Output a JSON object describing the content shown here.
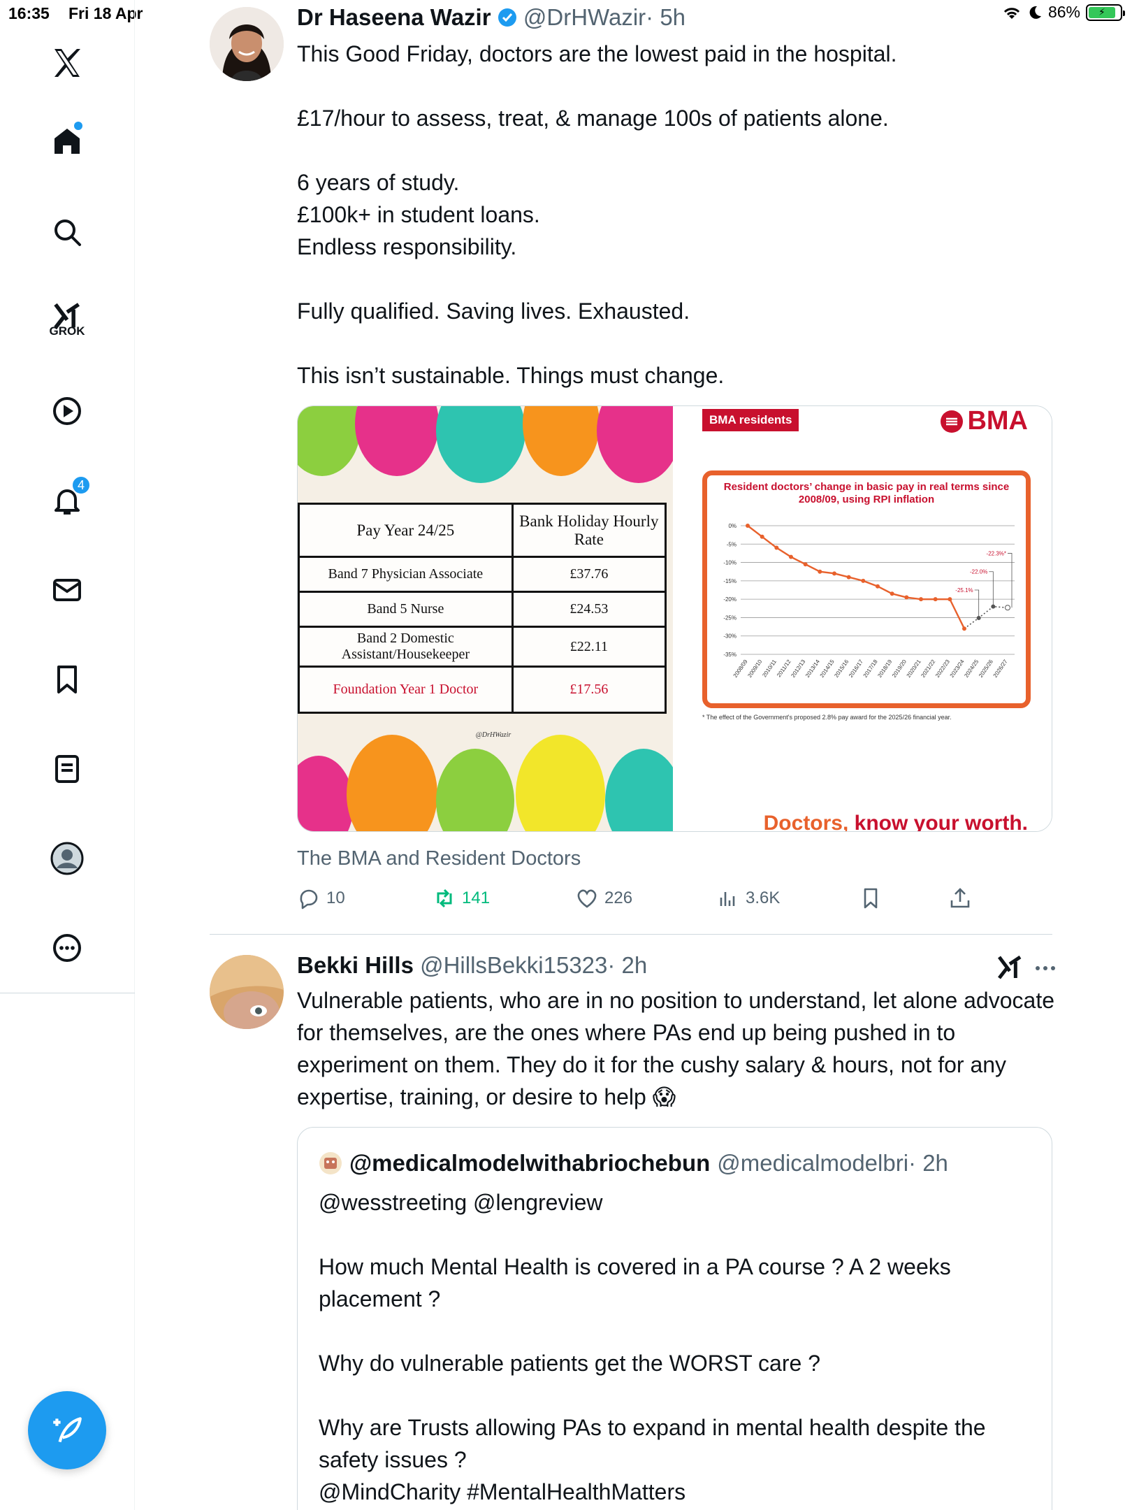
{
  "status_bar": {
    "time": "16:35",
    "date": "Fri 18 Apr",
    "battery": "86%"
  },
  "sidebar": {
    "items": [
      {
        "name": "x-logo"
      },
      {
        "name": "home"
      },
      {
        "name": "search"
      },
      {
        "name": "grok",
        "label": "GROK"
      },
      {
        "name": "videos"
      },
      {
        "name": "notifications",
        "badge": "4"
      },
      {
        "name": "messages"
      },
      {
        "name": "bookmarks"
      },
      {
        "name": "lists"
      },
      {
        "name": "profile"
      },
      {
        "name": "more"
      }
    ],
    "compose_icon": "compose-icon"
  },
  "tweet1": {
    "name": "Dr Haseena Wazir",
    "handle": "@DrHWazir",
    "time": "· 5h",
    "text": "This Good Friday, doctors are the lowest paid in the hospital.\n\n£17/hour to assess, treat, & manage 100s of patients alone.\n\n6 years of study.\n£100k+ in student loans.\nEndless responsibility.\n\nFully qualified. Saving lives. Exhausted.\n\nThis isn’t sustainable. Things must change.",
    "caption": "The BMA and Resident Doctors",
    "replies": "10",
    "reposts": "141",
    "likes": "226",
    "views": "3.6K",
    "pay_table": {
      "headers": [
        "Pay Year 24/25",
        "Bank Holiday Hourly Rate"
      ],
      "rows": [
        {
          "role": "Band 7 Physician Associate",
          "rate": "£37.76"
        },
        {
          "role": "Band 5 Nurse",
          "rate": "£24.53"
        },
        {
          "role": "Band 2 Domestic Assistant/Housekeeper",
          "rate": "£22.11"
        },
        {
          "role": "Foundation Year 1 Doctor",
          "rate": "£17.56"
        }
      ],
      "handle_note": "@DrHWazir"
    },
    "bma": {
      "tag": "BMA residents",
      "logo": "BMA",
      "title": "Resident doctors’ change in basic pay in real terms since 2008/09, using RPI inflation",
      "footnote": "* The effect of the Government's proposed 2.8% pay award for the 2025/26 financial year.",
      "slogan_a": "Doctors,",
      "slogan_b": " know your worth."
    }
  },
  "chart_data": {
    "type": "line",
    "title": "Resident doctors’ change in basic pay in real terms since 2008/09, using RPI inflation",
    "x": [
      "2008/09",
      "2009/10",
      "2010/11",
      "2011/12",
      "2012/13",
      "2013/14",
      "2014/15",
      "2015/16",
      "2016/17",
      "2017/18",
      "2018/19",
      "2019/20",
      "2020/21",
      "2021/22",
      "2022/23",
      "2023/24",
      "2024/25",
      "2025/26",
      "2026/27"
    ],
    "series": [
      {
        "values": [
          0,
          -3,
          -6,
          -8.5,
          -10.5,
          -12.5,
          -13,
          -14,
          -15,
          -16.5,
          -18.5,
          -19.5,
          -20,
          -20,
          -20,
          -28,
          -25.1,
          -22,
          -22.3
        ]
      }
    ],
    "annotations": [
      "-22.3%*",
      "-22.0%",
      "-25.1%"
    ],
    "yticks": [
      "0%",
      "-5%",
      "-10%",
      "-15%",
      "-20%",
      "-25%",
      "-30%",
      "-35%"
    ],
    "ylim": [
      -35,
      0
    ]
  },
  "tweet2": {
    "name": "Bekki Hills",
    "handle": "@HillsBekki15323",
    "time": "· 2h",
    "text": "Vulnerable patients, who are in no position to understand, let alone advocate for themselves, are the ones where PAs end up being pushed in to experiment on them. They do it for the cushy salary & hours, not for any expertise, training, or desire to help 😱",
    "quote": {
      "name": "@medicalmodelwithabriochebun",
      "handle": "@medicalmodelbri",
      "time": "· 2h",
      "text": "@wesstreeting @lengreview\n\nHow much Mental Health is covered in a PA course ? A 2 weeks placement ?\n\nWhy do vulnerable patients get the WORST care ?\n\nWhy are Trusts allowing PAs to expand in mental health despite the safety issues ?\n@MindCharity #MentalHealthMatters"
    }
  }
}
